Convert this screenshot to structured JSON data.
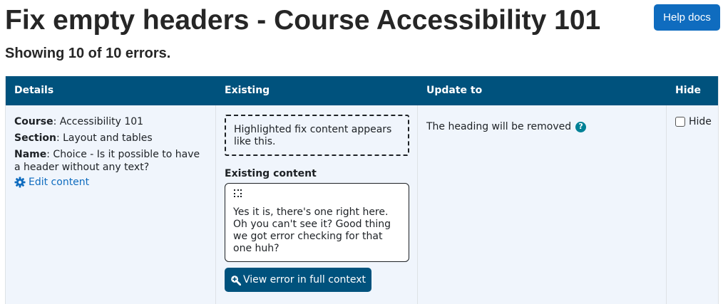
{
  "header": {
    "title": "Fix empty headers - Course Accessibility 101",
    "help_label": "Help docs",
    "summary": "Showing 10 of 10 errors."
  },
  "table": {
    "columns": [
      "Details",
      "Existing",
      "Update to",
      "Hide"
    ],
    "row": {
      "course_label": "Course",
      "course_value": ": Accessibility 101",
      "section_label": "Section",
      "section_value": ": Layout and tables",
      "name_label": "Name",
      "name_value": ": Choice - Is it possible to have a header without any text?",
      "edit_label": "Edit content",
      "highlight_text": "Highlighted fix content appears like this.",
      "existing_label": "Existing content",
      "existing_text": "Yes it is, there's one right here. Oh you can't see it? Good thing we got error checking for that one huh?",
      "view_label": "View error in full context",
      "update_text": "The heading will be removed",
      "hide_label": "Hide",
      "hide_checked": false
    }
  },
  "colors": {
    "header_bg": "#00527d",
    "help_button": "#0f6cbf",
    "row_bg": "#f0f5fc",
    "link": "#0f6cbf",
    "help_icon": "#008196"
  },
  "icons": [
    "gear-icon",
    "zoom-in-icon",
    "question-icon",
    "dotted-square-icon"
  ]
}
